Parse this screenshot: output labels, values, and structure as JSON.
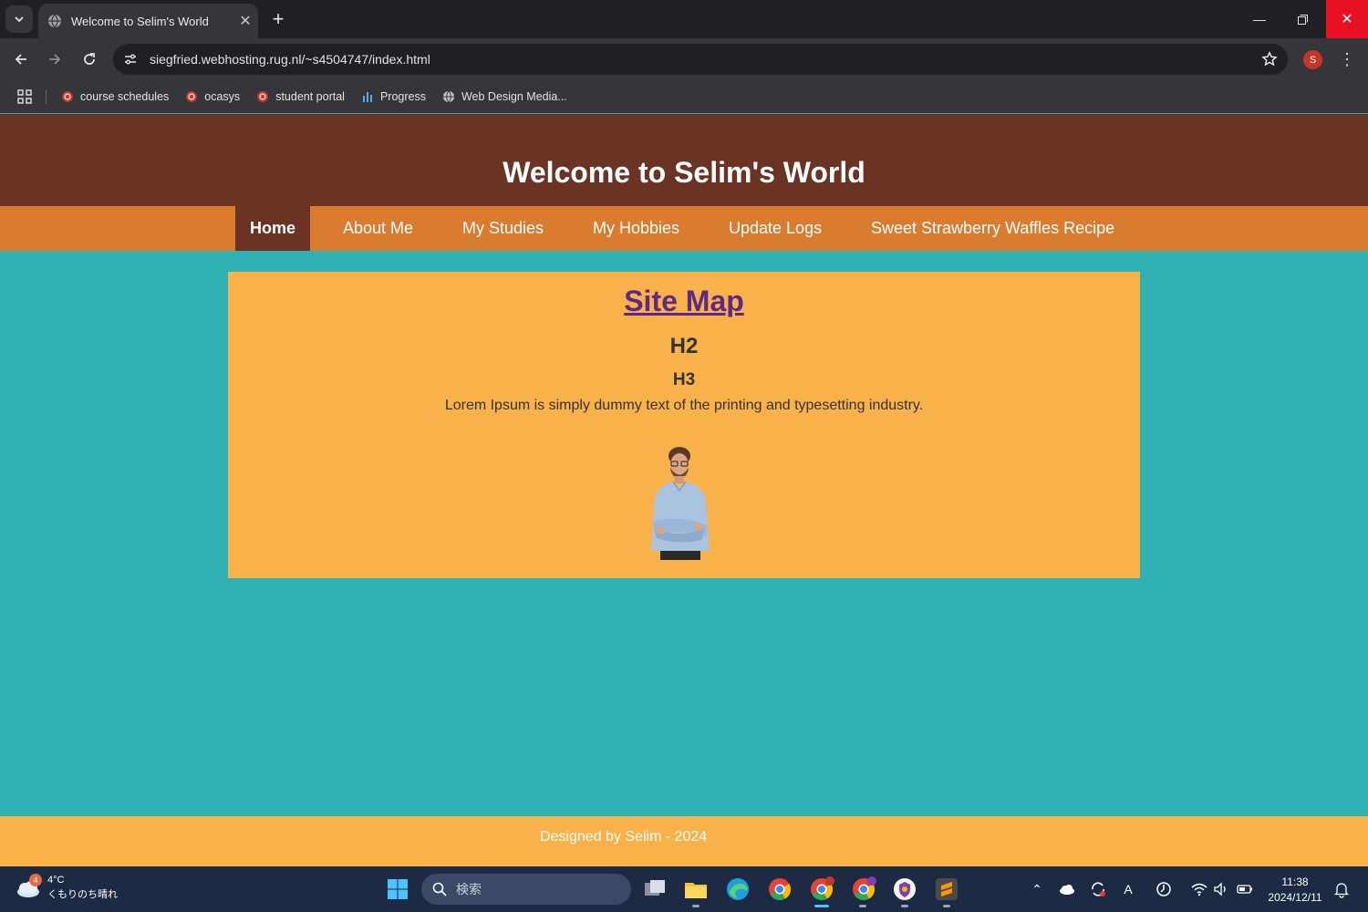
{
  "browser": {
    "tab_title": "Welcome to Selim's World",
    "url": "siegfried.webhosting.rug.nl/~s4504747/index.html",
    "profile_initial": "S",
    "bookmarks": [
      {
        "label": "course schedules",
        "icon": "rug-icon"
      },
      {
        "label": "ocasys",
        "icon": "rug-icon"
      },
      {
        "label": "student portal",
        "icon": "rug-icon"
      },
      {
        "label": "Progress",
        "icon": "bar-chart-icon"
      },
      {
        "label": "Web Design Media...",
        "icon": "globe-icon"
      }
    ]
  },
  "page": {
    "header_title": "Welcome to Selim's World",
    "nav": [
      {
        "label": "Home",
        "active": true
      },
      {
        "label": "About Me",
        "active": false
      },
      {
        "label": "My Studies",
        "active": false
      },
      {
        "label": "My Hobbies",
        "active": false
      },
      {
        "label": "Update Logs",
        "active": false
      },
      {
        "label": "Sweet Strawberry Waffles Recipe",
        "active": false
      }
    ],
    "content": {
      "h1": "Site Map",
      "h2": "H2",
      "h3": "H3",
      "paragraph": "Lorem Ipsum is simply dummy text of the printing and typesetting industry."
    },
    "footer": "Designed by Selim - 2024"
  },
  "taskbar": {
    "weather_temp": "4°C",
    "weather_desc": "くもりのち晴れ",
    "weather_badge": "4",
    "search_placeholder": "検索",
    "time": "11:38",
    "date": "2024/12/11"
  },
  "colors": {
    "header_bg": "#6b3323",
    "nav_bg": "#d97c2f",
    "page_bg": "#2fb0b3",
    "content_bg": "#f8b249",
    "link": "#5b2a86"
  }
}
